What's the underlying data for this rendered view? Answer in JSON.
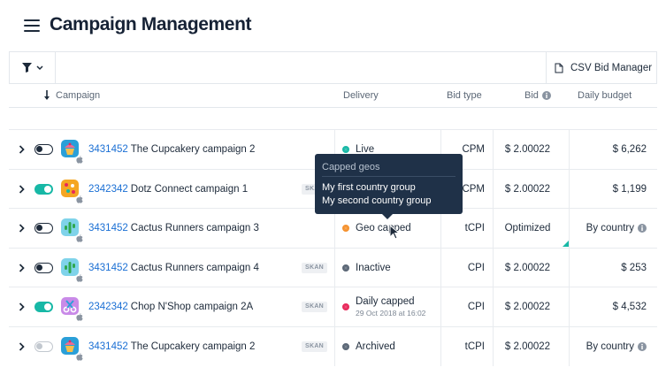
{
  "header": {
    "title": "Campaign Management",
    "menu_icon": "hamburger-menu-icon"
  },
  "toolbar": {
    "filter_icon": "filter-icon",
    "csv_label": "CSV Bid Manager",
    "csv_icon": "document-icon"
  },
  "columns": {
    "campaign": "Campaign",
    "delivery": "Delivery",
    "bid_type": "Bid type",
    "bid": "Bid",
    "daily_budget": "Daily budget"
  },
  "rows": [
    {
      "app_id": "3431452",
      "name": "The Cupcakery campaign 2",
      "toggle": "off",
      "icon": "cupcake-app-icon",
      "skan": "",
      "delivery": "Live",
      "delivery_sub": "",
      "status_color": "#17b8a6",
      "status_style": "ring",
      "bid_type": "CPM",
      "bid": "$ 2.00022",
      "budget": "$ 6,262",
      "budget_info": false
    },
    {
      "app_id": "2342342",
      "name": "Dotz Connect campaign 1",
      "toggle": "on",
      "icon": "dotz-app-icon",
      "skan": "SKAN",
      "delivery": "",
      "delivery_sub": "",
      "status_color": "",
      "status_style": "none",
      "bid_type": "CPM",
      "bid": "$ 2.00022",
      "budget": "$ 1,199",
      "budget_info": false
    },
    {
      "app_id": "3431452",
      "name": "Cactus Runners campaign 3",
      "toggle": "off",
      "icon": "cactus-app-icon",
      "skan": "",
      "delivery": "Geo capped",
      "delivery_sub": "",
      "status_color": "#f5922f",
      "status_style": "ring",
      "bid_type": "tCPI",
      "bid": "Optimized",
      "budget": "By country",
      "budget_info": true
    },
    {
      "app_id": "3431452",
      "name": "Cactus Runners campaign 4",
      "toggle": "off",
      "icon": "cactus-app-icon",
      "skan": "SKAN",
      "delivery": "Inactive",
      "delivery_sub": "",
      "status_color": "#5b6776",
      "status_style": "ring",
      "bid_type": "CPI",
      "bid": "$ 2.00022",
      "budget": "$ 253",
      "budget_info": false
    },
    {
      "app_id": "2342342",
      "name": "Chop N'Shop campaign 2A",
      "toggle": "on",
      "icon": "scissors-app-icon",
      "skan": "SKAN",
      "delivery": "Daily capped",
      "delivery_sub": "29 Oct 2018 at 16:02",
      "status_color": "#e8285a",
      "status_style": "ring",
      "bid_type": "CPI",
      "bid": "$ 2.00022",
      "budget": "$ 4,532",
      "budget_info": false
    },
    {
      "app_id": "3431452",
      "name": "The Cupcakery campaign 2",
      "toggle": "dim",
      "icon": "cupcake-app-icon",
      "skan": "SKAN",
      "delivery": "Archived",
      "delivery_sub": "",
      "status_color": "#5b6776",
      "status_style": "ring",
      "bid_type": "tCPI",
      "bid": "$ 2.00022",
      "budget": "By country",
      "budget_info": true
    }
  ],
  "tooltip": {
    "title": "Capped geos",
    "items": [
      "My first country group",
      "My second country group"
    ]
  }
}
